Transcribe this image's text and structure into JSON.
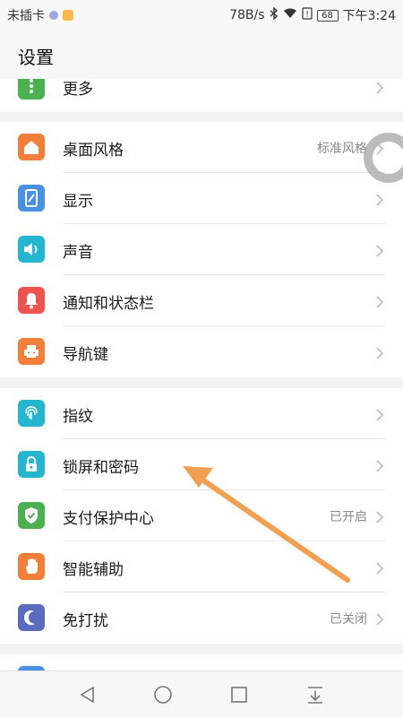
{
  "status_bar": {
    "carrier": "未插卡",
    "speed": "78B/s",
    "battery": "68",
    "time": "下午3:24"
  },
  "header": {
    "title": "设置"
  },
  "groups": [
    {
      "items": [
        {
          "label": "更多",
          "icon": "more-icon",
          "color": "#4caf50"
        }
      ]
    },
    {
      "items": [
        {
          "label": "桌面风格",
          "value": "标准风格",
          "icon": "home-icon",
          "color": "#f07f3a"
        },
        {
          "label": "显示",
          "icon": "display-icon",
          "color": "#4a90e2"
        },
        {
          "label": "声音",
          "icon": "sound-icon",
          "color": "#26b5cf"
        },
        {
          "label": "通知和状态栏",
          "icon": "notification-bell-icon",
          "color": "#ef5350"
        },
        {
          "label": "导航键",
          "icon": "navigation-key-icon",
          "color": "#f07f3a"
        }
      ]
    },
    {
      "items": [
        {
          "label": "指纹",
          "icon": "fingerprint-icon",
          "color": "#26b5cf"
        },
        {
          "label": "锁屏和密码",
          "icon": "lock-icon",
          "color": "#26b5cf"
        },
        {
          "label": "支付保护中心",
          "value": "已开启",
          "icon": "shield-check-icon",
          "color": "#4caf50"
        },
        {
          "label": "智能辅助",
          "icon": "hand-icon",
          "color": "#f07f3a"
        },
        {
          "label": "免打扰",
          "value": "已关闭",
          "icon": "moon-icon",
          "color": "#5c6bc0"
        }
      ]
    }
  ],
  "colors": {
    "annotation_arrow": "#f0a050"
  }
}
